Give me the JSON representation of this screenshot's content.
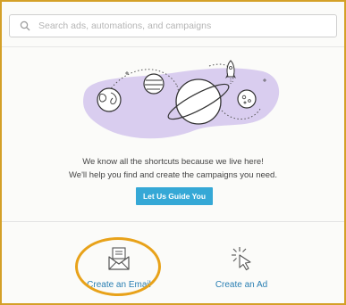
{
  "search": {
    "placeholder": "Search ads, automations, and campaigns",
    "icon": "search-icon"
  },
  "hero": {
    "illustration": "space-planets-illustration",
    "line1": "We know all the shortcuts because we live here!",
    "line2": "We'll help you find and create the campaigns you need.",
    "cta_label": "Let Us Guide You"
  },
  "actions": [
    {
      "label": "Create an Email",
      "icon": "email-icon"
    },
    {
      "label": "Create an Ad",
      "icon": "cursor-click-icon"
    }
  ],
  "colors": {
    "accent_blue": "#35a8d6",
    "link_blue": "#2a7fb3",
    "blob_purple": "#d9cdef",
    "highlight_orange": "#e8a21a"
  }
}
